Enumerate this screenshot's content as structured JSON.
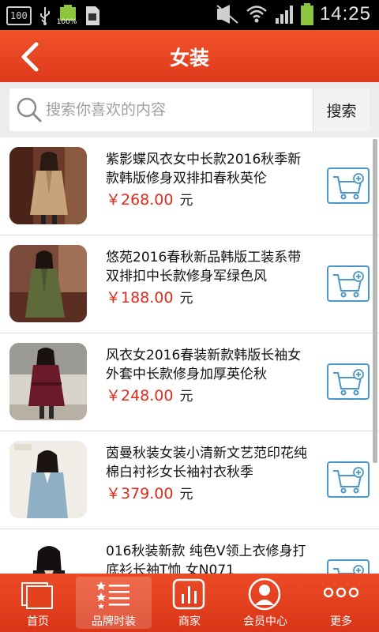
{
  "status_bar": {
    "battery_saver": "100",
    "battery_percent": "100%",
    "time": "14:25"
  },
  "header": {
    "title": "女装"
  },
  "search": {
    "placeholder": "搜索你喜欢的内容",
    "value": "",
    "button_label": "搜索"
  },
  "products": [
    {
      "name": "紫影蝶风衣女中长款2016秋季新款韩版修身双排扣春秋英伦",
      "price": "￥268.00",
      "unit": "元"
    },
    {
      "name": "悠苑2016春秋新品韩版工装系带双排扣中长款修身军绿色风",
      "price": "￥188.00",
      "unit": "元"
    },
    {
      "name": "风衣女2016春装新款韩版长袖女外套中长款修身加厚英伦秋",
      "price": "￥248.00",
      "unit": "元"
    },
    {
      "name": "茵曼秋装女装小清新文艺范印花纯棉白衬衫女长袖衬衣秋季",
      "price": "￥379.00",
      "unit": "元"
    },
    {
      "name": "016秋装新款 纯色V领上衣修身打底衫长袖T恤 女N071",
      "price": "",
      "unit": ""
    }
  ],
  "tabs": [
    {
      "label": "首页",
      "icon": "home-icon"
    },
    {
      "label": "品牌时装",
      "icon": "list-icon",
      "active": true
    },
    {
      "label": "商家",
      "icon": "store-icon"
    },
    {
      "label": "会员中心",
      "icon": "member-icon"
    },
    {
      "label": "更多",
      "icon": "more-icon"
    }
  ],
  "colors": {
    "accent": "#e4421f",
    "price": "#e02a1a",
    "cart_border": "#4a97c8"
  }
}
